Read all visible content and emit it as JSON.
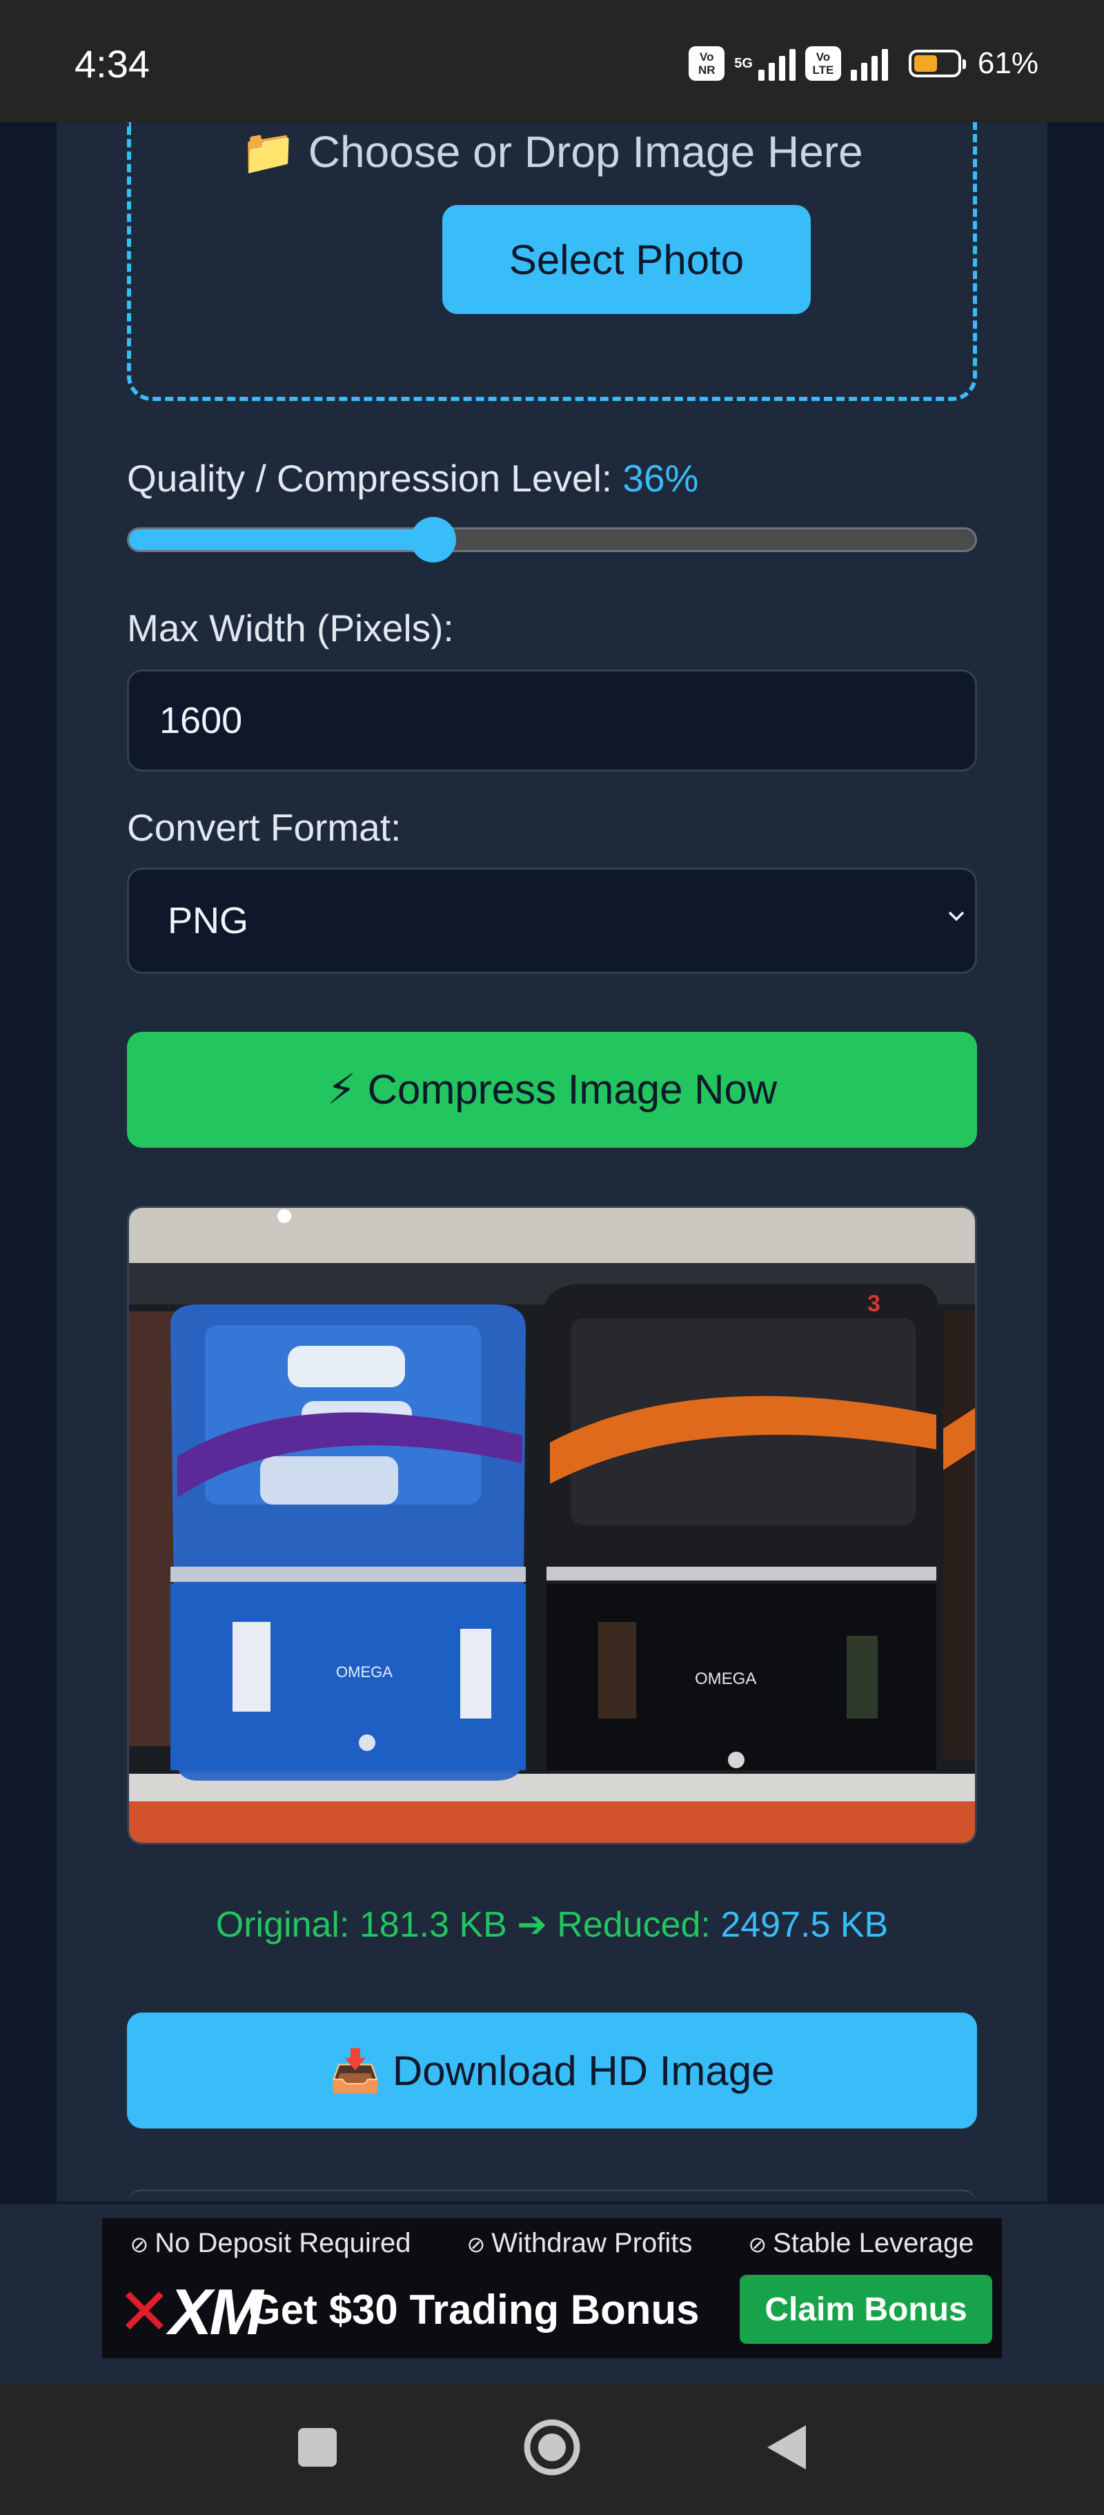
{
  "status_bar": {
    "time": "4:34",
    "sim1_badge": [
      "Vo",
      "NR"
    ],
    "network": "5G",
    "sim2_badge": [
      "Vo",
      "LTE"
    ],
    "battery_percent": "61%",
    "battery_level": 0.61,
    "battery_color": "#f5a623"
  },
  "upload": {
    "drop_icon": "folder-icon",
    "drop_text": "📁 Choose or Drop Image Here",
    "select_button": "Select Photo"
  },
  "quality": {
    "label": "Quality / Compression Level: ",
    "value_text": "36%",
    "value": 0.36
  },
  "max_width": {
    "label": "Max Width (Pixels):",
    "value": "1600"
  },
  "format": {
    "label": "Convert Format:",
    "selected": "PNG"
  },
  "compress_button": "⚡ Compress Image Now",
  "result": {
    "original_text": "Original: 181.3 KB ➔ Reduced: ",
    "reduced_text": "2497.5 KB"
  },
  "download_button": "📥 Download HD Image",
  "ad": {
    "points": [
      "No Deposit Required",
      "Withdraw Profits",
      "Stable Leverage"
    ],
    "logo": "XM",
    "headline": "Get $30 Trading Bonus",
    "cta": "Claim Bonus"
  },
  "colors": {
    "accent": "#38bdf8",
    "success": "#22c55e",
    "card": "#1e293b",
    "background": "#0f172a"
  },
  "nav_bar": {
    "icons": [
      "recents-square-icon",
      "home-circle-icon",
      "back-triangle-icon"
    ]
  }
}
